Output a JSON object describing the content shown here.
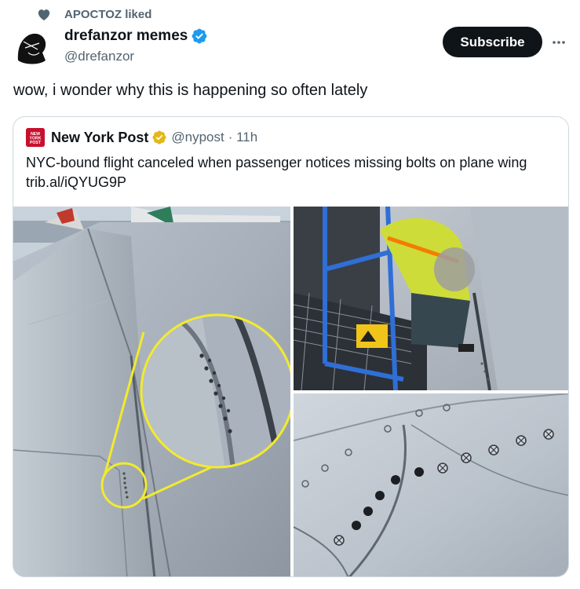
{
  "social_context": {
    "text": "APOCTOZ liked",
    "icon": "heart-icon"
  },
  "author": {
    "name": "drefanzor memes",
    "handle": "@drefanzor",
    "verified": true
  },
  "actions": {
    "subscribe_label": "Subscribe",
    "more_icon": "more-icon"
  },
  "tweet": {
    "text": "wow, i wonder why this is happening so often lately"
  },
  "quote": {
    "name": "New York Post",
    "handle": "@nypost",
    "time": "· 11h",
    "text": "NYC-bound flight canceled when passenger notices missing bolts on plane wing trib.al/iQYUG9P",
    "avatar_text": "NEW YORK POST",
    "media": [
      {
        "name": "photo-wing-zoom-circle"
      },
      {
        "name": "photo-worker-inspecting-wing"
      },
      {
        "name": "photo-wing-bolts-closeup"
      }
    ]
  },
  "colors": {
    "accent_blue": "#1d9bf0",
    "gold_badge": "#e2b719",
    "nypost_red": "#c8102e",
    "text_primary": "#0f1419",
    "text_secondary": "#536471",
    "highlight_yellow": "#f2ea2e"
  }
}
